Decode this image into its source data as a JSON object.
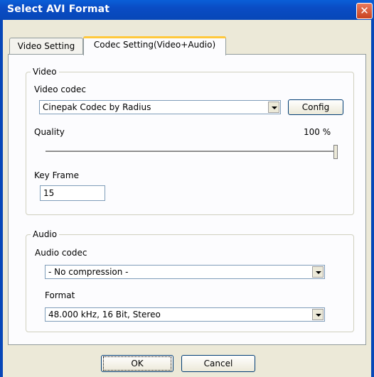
{
  "window": {
    "title": "Select AVI Format",
    "close_icon": "close-icon"
  },
  "tabs": [
    {
      "label": "Video Setting",
      "active": false
    },
    {
      "label": "Codec Setting(Video+Audio)",
      "active": true
    }
  ],
  "video": {
    "group_label": "Video",
    "codec_label": "Video codec",
    "codec_value": "Cinepak Codec by Radius",
    "config_label": "Config",
    "quality_label": "Quality",
    "quality_value": "100 %",
    "quality_level": 1.0,
    "keyframe_label": "Key Frame",
    "keyframe_value": "15"
  },
  "audio": {
    "group_label": "Audio",
    "codec_label": "Audio codec",
    "codec_value": "- No compression -",
    "format_label": "Format",
    "format_value": "48.000 kHz, 16 Bit, Stereo"
  },
  "buttons": {
    "ok": "OK",
    "cancel": "Cancel"
  }
}
